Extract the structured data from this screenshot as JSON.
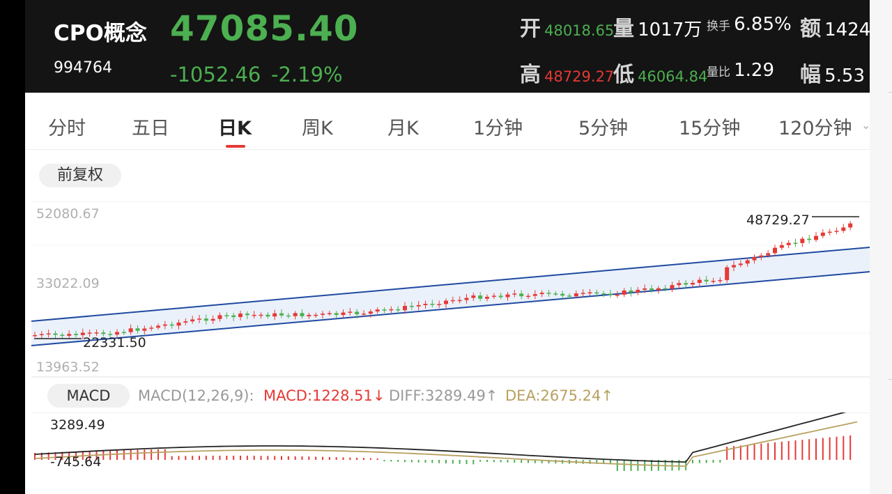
{
  "header": {
    "name": "CPO概念",
    "code": "994764",
    "price": "47085.40",
    "change": "-1052.46",
    "change_pct": "-2.19%",
    "open_label": "开",
    "open": "48018.65",
    "volume_label": "量",
    "volume": "1017万",
    "turnover_label": "换手",
    "turnover": "6.85%",
    "amount_label": "额",
    "amount": "1424",
    "high_label": "高",
    "high": "48729.27",
    "low_label": "低",
    "low": "46064.84",
    "vol_ratio_label": "量比",
    "vol_ratio": "1.29",
    "amp_label": "幅",
    "amp": "5.53"
  },
  "tabs": [
    "分时",
    "五日",
    "日K",
    "周K",
    "月K",
    "1分钟",
    "5分钟",
    "15分钟",
    "120分钟"
  ],
  "active_tab": "日K",
  "adjust_button": "前复权",
  "chart": {
    "y_labels": [
      "52080.67",
      "33022.09",
      "13963.52"
    ],
    "max_label": "48729.27",
    "min_label": "22331.50"
  },
  "macd": {
    "button": "MACD",
    "params": "MACD(12,26,9):",
    "macd": "MACD:1228.51↓",
    "diff": "DIFF:3289.49↑",
    "dea": "DEA:2675.24↑",
    "top_label": "3289.49",
    "bottom_label": "-745.64"
  },
  "colors": {
    "up": "#e53935",
    "down": "#4caf50",
    "channel": "#1f4aa0",
    "dea": "#b8a060"
  }
}
